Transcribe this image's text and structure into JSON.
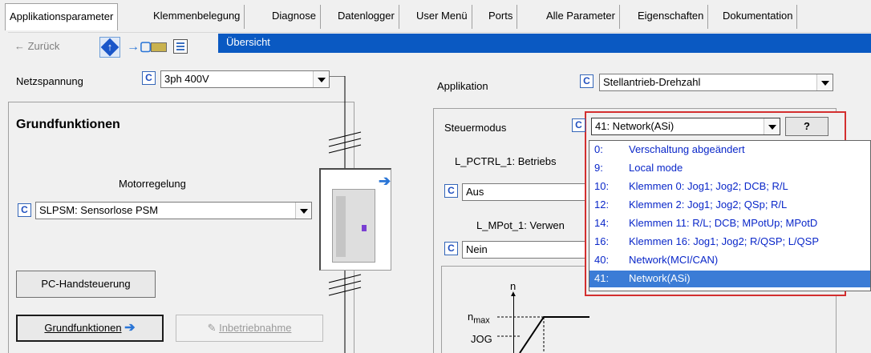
{
  "tabs": [
    {
      "label": "Applikationsparameter",
      "active": true
    },
    {
      "label": "Klemmenbelegung"
    },
    {
      "label": "Diagnose"
    },
    {
      "label": "Datenlogger"
    },
    {
      "label": "User Menü"
    },
    {
      "label": "Ports"
    },
    {
      "label": "Alle Parameter"
    },
    {
      "label": "Eigenschaften"
    },
    {
      "label": "Dokumentation"
    }
  ],
  "nav": {
    "back_label": "← Zurück",
    "breadcrumb": "Übersicht"
  },
  "param_c": "C",
  "netzspannung": {
    "label": "Netzspannung",
    "value": "3ph 400V"
  },
  "applikation": {
    "label": "Applikation",
    "value": "Stellantrieb-Drehzahl"
  },
  "grundfunktionen": {
    "title": "Grundfunktionen"
  },
  "motorregelung": {
    "label": "Motorregelung",
    "value": "SLPSM: Sensorlose PSM"
  },
  "buttons": {
    "pc_hand": "PC-Handsteuerung",
    "grund": "Grundfunktionen",
    "inbetrieb": "Inbetriebnahme"
  },
  "steuermodus": {
    "label": "Steuermodus",
    "value": "41:  Network(ASi)",
    "help": "?",
    "options": [
      {
        "code": "0:",
        "text": "Verschaltung abgeändert"
      },
      {
        "code": "9:",
        "text": "Local mode"
      },
      {
        "code": "10:",
        "text": "Klemmen  0: Jog1; Jog2; DCB; R/L"
      },
      {
        "code": "12:",
        "text": "Klemmen  2: Jog1; Jog2; QSp; R/L"
      },
      {
        "code": "14:",
        "text": "Klemmen 11: R/L; DCB; MPotUp; MPotD"
      },
      {
        "code": "16:",
        "text": "Klemmen 16: Jog1; Jog2; R/QSP; L/QSP"
      },
      {
        "code": "40:",
        "text": "Network(MCI/CAN)"
      },
      {
        "code": "41:",
        "text": "Network(ASi)",
        "selected": true
      }
    ]
  },
  "pctrl": {
    "label": "L_PCTRL_1: Betriebs",
    "value": "Aus"
  },
  "mpot": {
    "label": "L_MPot_1: Verwen",
    "value": "Nein"
  },
  "chart_labels": {
    "n": "n",
    "nmax": "n",
    "nmax_sub": "max",
    "jog": "JOG"
  },
  "colors": {
    "breadcrumb_bg": "#0a59c2",
    "selection": "#3b7cd6",
    "highlight_frame": "#d32f2f",
    "option_text": "#0a27c9"
  }
}
